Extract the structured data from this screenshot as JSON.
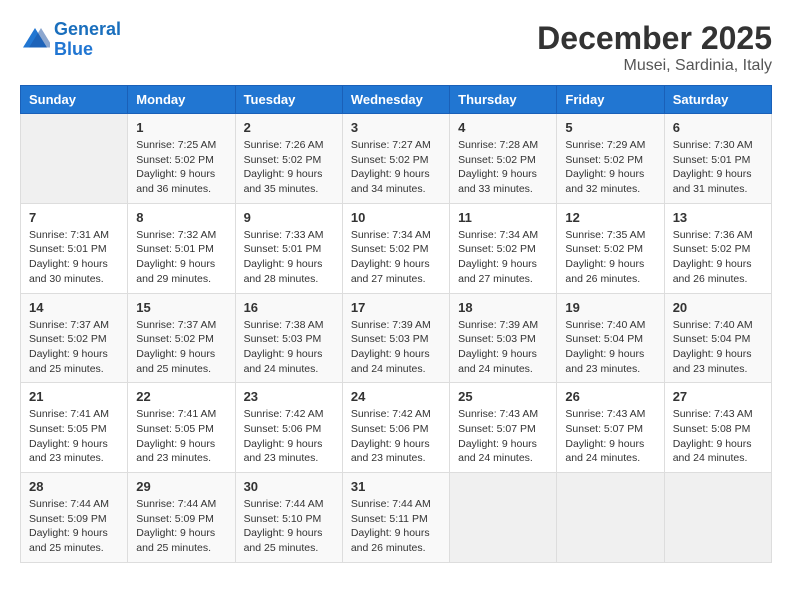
{
  "logo": {
    "line1": "General",
    "line2": "Blue"
  },
  "title": "December 2025",
  "location": "Musei, Sardinia, Italy",
  "days_of_week": [
    "Sunday",
    "Monday",
    "Tuesday",
    "Wednesday",
    "Thursday",
    "Friday",
    "Saturday"
  ],
  "weeks": [
    [
      {
        "day": "",
        "sunrise": "",
        "sunset": "",
        "daylight": ""
      },
      {
        "day": "1",
        "sunrise": "Sunrise: 7:25 AM",
        "sunset": "Sunset: 5:02 PM",
        "daylight": "Daylight: 9 hours and 36 minutes."
      },
      {
        "day": "2",
        "sunrise": "Sunrise: 7:26 AM",
        "sunset": "Sunset: 5:02 PM",
        "daylight": "Daylight: 9 hours and 35 minutes."
      },
      {
        "day": "3",
        "sunrise": "Sunrise: 7:27 AM",
        "sunset": "Sunset: 5:02 PM",
        "daylight": "Daylight: 9 hours and 34 minutes."
      },
      {
        "day": "4",
        "sunrise": "Sunrise: 7:28 AM",
        "sunset": "Sunset: 5:02 PM",
        "daylight": "Daylight: 9 hours and 33 minutes."
      },
      {
        "day": "5",
        "sunrise": "Sunrise: 7:29 AM",
        "sunset": "Sunset: 5:02 PM",
        "daylight": "Daylight: 9 hours and 32 minutes."
      },
      {
        "day": "6",
        "sunrise": "Sunrise: 7:30 AM",
        "sunset": "Sunset: 5:01 PM",
        "daylight": "Daylight: 9 hours and 31 minutes."
      }
    ],
    [
      {
        "day": "7",
        "sunrise": "Sunrise: 7:31 AM",
        "sunset": "Sunset: 5:01 PM",
        "daylight": "Daylight: 9 hours and 30 minutes."
      },
      {
        "day": "8",
        "sunrise": "Sunrise: 7:32 AM",
        "sunset": "Sunset: 5:01 PM",
        "daylight": "Daylight: 9 hours and 29 minutes."
      },
      {
        "day": "9",
        "sunrise": "Sunrise: 7:33 AM",
        "sunset": "Sunset: 5:01 PM",
        "daylight": "Daylight: 9 hours and 28 minutes."
      },
      {
        "day": "10",
        "sunrise": "Sunrise: 7:34 AM",
        "sunset": "Sunset: 5:02 PM",
        "daylight": "Daylight: 9 hours and 27 minutes."
      },
      {
        "day": "11",
        "sunrise": "Sunrise: 7:34 AM",
        "sunset": "Sunset: 5:02 PM",
        "daylight": "Daylight: 9 hours and 27 minutes."
      },
      {
        "day": "12",
        "sunrise": "Sunrise: 7:35 AM",
        "sunset": "Sunset: 5:02 PM",
        "daylight": "Daylight: 9 hours and 26 minutes."
      },
      {
        "day": "13",
        "sunrise": "Sunrise: 7:36 AM",
        "sunset": "Sunset: 5:02 PM",
        "daylight": "Daylight: 9 hours and 26 minutes."
      }
    ],
    [
      {
        "day": "14",
        "sunrise": "Sunrise: 7:37 AM",
        "sunset": "Sunset: 5:02 PM",
        "daylight": "Daylight: 9 hours and 25 minutes."
      },
      {
        "day": "15",
        "sunrise": "Sunrise: 7:37 AM",
        "sunset": "Sunset: 5:02 PM",
        "daylight": "Daylight: 9 hours and 25 minutes."
      },
      {
        "day": "16",
        "sunrise": "Sunrise: 7:38 AM",
        "sunset": "Sunset: 5:03 PM",
        "daylight": "Daylight: 9 hours and 24 minutes."
      },
      {
        "day": "17",
        "sunrise": "Sunrise: 7:39 AM",
        "sunset": "Sunset: 5:03 PM",
        "daylight": "Daylight: 9 hours and 24 minutes."
      },
      {
        "day": "18",
        "sunrise": "Sunrise: 7:39 AM",
        "sunset": "Sunset: 5:03 PM",
        "daylight": "Daylight: 9 hours and 24 minutes."
      },
      {
        "day": "19",
        "sunrise": "Sunrise: 7:40 AM",
        "sunset": "Sunset: 5:04 PM",
        "daylight": "Daylight: 9 hours and 23 minutes."
      },
      {
        "day": "20",
        "sunrise": "Sunrise: 7:40 AM",
        "sunset": "Sunset: 5:04 PM",
        "daylight": "Daylight: 9 hours and 23 minutes."
      }
    ],
    [
      {
        "day": "21",
        "sunrise": "Sunrise: 7:41 AM",
        "sunset": "Sunset: 5:05 PM",
        "daylight": "Daylight: 9 hours and 23 minutes."
      },
      {
        "day": "22",
        "sunrise": "Sunrise: 7:41 AM",
        "sunset": "Sunset: 5:05 PM",
        "daylight": "Daylight: 9 hours and 23 minutes."
      },
      {
        "day": "23",
        "sunrise": "Sunrise: 7:42 AM",
        "sunset": "Sunset: 5:06 PM",
        "daylight": "Daylight: 9 hours and 23 minutes."
      },
      {
        "day": "24",
        "sunrise": "Sunrise: 7:42 AM",
        "sunset": "Sunset: 5:06 PM",
        "daylight": "Daylight: 9 hours and 23 minutes."
      },
      {
        "day": "25",
        "sunrise": "Sunrise: 7:43 AM",
        "sunset": "Sunset: 5:07 PM",
        "daylight": "Daylight: 9 hours and 24 minutes."
      },
      {
        "day": "26",
        "sunrise": "Sunrise: 7:43 AM",
        "sunset": "Sunset: 5:07 PM",
        "daylight": "Daylight: 9 hours and 24 minutes."
      },
      {
        "day": "27",
        "sunrise": "Sunrise: 7:43 AM",
        "sunset": "Sunset: 5:08 PM",
        "daylight": "Daylight: 9 hours and 24 minutes."
      }
    ],
    [
      {
        "day": "28",
        "sunrise": "Sunrise: 7:44 AM",
        "sunset": "Sunset: 5:09 PM",
        "daylight": "Daylight: 9 hours and 25 minutes."
      },
      {
        "day": "29",
        "sunrise": "Sunrise: 7:44 AM",
        "sunset": "Sunset: 5:09 PM",
        "daylight": "Daylight: 9 hours and 25 minutes."
      },
      {
        "day": "30",
        "sunrise": "Sunrise: 7:44 AM",
        "sunset": "Sunset: 5:10 PM",
        "daylight": "Daylight: 9 hours and 25 minutes."
      },
      {
        "day": "31",
        "sunrise": "Sunrise: 7:44 AM",
        "sunset": "Sunset: 5:11 PM",
        "daylight": "Daylight: 9 hours and 26 minutes."
      },
      {
        "day": "",
        "sunrise": "",
        "sunset": "",
        "daylight": ""
      },
      {
        "day": "",
        "sunrise": "",
        "sunset": "",
        "daylight": ""
      },
      {
        "day": "",
        "sunrise": "",
        "sunset": "",
        "daylight": ""
      }
    ]
  ]
}
